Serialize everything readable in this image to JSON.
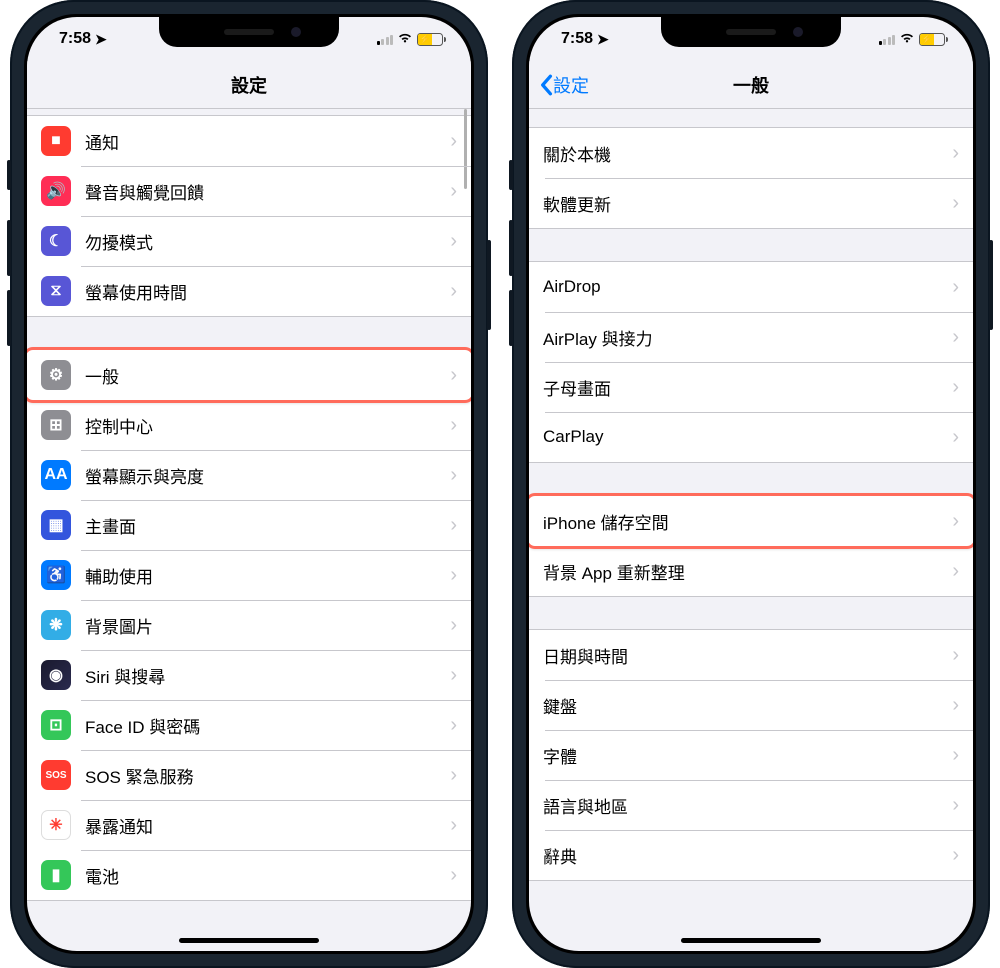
{
  "status": {
    "time": "7:58",
    "location_indicator": "↗"
  },
  "phone_left": {
    "nav_title": "設定",
    "groups": [
      {
        "items": [
          {
            "icon_name": "notification-icon",
            "icon_glyph": "■",
            "icon_bg": "#ff3b30",
            "label": "通知"
          },
          {
            "icon_name": "sound-icon",
            "icon_glyph": "🔊",
            "icon_bg": "#ff2d55",
            "label": "聲音與觸覺回饋"
          },
          {
            "icon_name": "dnd-icon",
            "icon_glyph": "☾",
            "icon_bg": "#5856d6",
            "label": "勿擾模式"
          },
          {
            "icon_name": "screentime-icon",
            "icon_glyph": "⧖",
            "icon_bg": "#5856d6",
            "label": "螢幕使用時間"
          }
        ]
      },
      {
        "items": [
          {
            "icon_name": "general-icon",
            "icon_glyph": "⚙",
            "icon_bg": "#8e8e93",
            "label": "一般",
            "highlight": true
          },
          {
            "icon_name": "control-center-icon",
            "icon_glyph": "⊞",
            "icon_bg": "#8e8e93",
            "label": "控制中心"
          },
          {
            "icon_name": "display-icon",
            "icon_glyph": "AA",
            "icon_bg": "#007aff",
            "label": "螢幕顯示與亮度"
          },
          {
            "icon_name": "home-screen-icon",
            "icon_glyph": "▦",
            "icon_bg": "#3355dd",
            "label": "主畫面"
          },
          {
            "icon_name": "accessibility-icon",
            "icon_glyph": "♿",
            "icon_bg": "#007aff",
            "label": "輔助使用"
          },
          {
            "icon_name": "wallpaper-icon",
            "icon_glyph": "❋",
            "icon_bg": "#32ade6",
            "label": "背景圖片"
          },
          {
            "icon_name": "siri-icon",
            "icon_glyph": "◉",
            "icon_bg": "siri",
            "label": "Siri 與搜尋"
          },
          {
            "icon_name": "faceid-icon",
            "icon_glyph": "⊡",
            "icon_bg": "#34c759",
            "label": "Face ID 與密碼"
          },
          {
            "icon_name": "sos-icon",
            "icon_glyph": "SOS",
            "icon_bg": "#ff3b30",
            "label": "SOS 緊急服務"
          },
          {
            "icon_name": "exposure-icon",
            "icon_glyph": "✳",
            "icon_bg": "#ffffff",
            "label": "暴露通知",
            "icon_fg": "#ff3b30"
          },
          {
            "icon_name": "battery-icon",
            "icon_glyph": "▮",
            "icon_bg": "#34c759",
            "label": "電池"
          }
        ]
      }
    ]
  },
  "phone_right": {
    "nav_back_label": "設定",
    "nav_title": "一般",
    "groups": [
      {
        "items": [
          {
            "label": "關於本機"
          },
          {
            "label": "軟體更新"
          }
        ]
      },
      {
        "items": [
          {
            "label": "AirDrop"
          },
          {
            "label": "AirPlay 與接力"
          },
          {
            "label": "子母畫面"
          },
          {
            "label": "CarPlay"
          }
        ]
      },
      {
        "items": [
          {
            "label": "iPhone 儲存空間",
            "highlight": true
          },
          {
            "label": "背景 App 重新整理"
          }
        ]
      },
      {
        "items": [
          {
            "label": "日期與時間"
          },
          {
            "label": "鍵盤"
          },
          {
            "label": "字體"
          },
          {
            "label": "語言與地區"
          },
          {
            "label": "辭典"
          }
        ]
      }
    ]
  }
}
